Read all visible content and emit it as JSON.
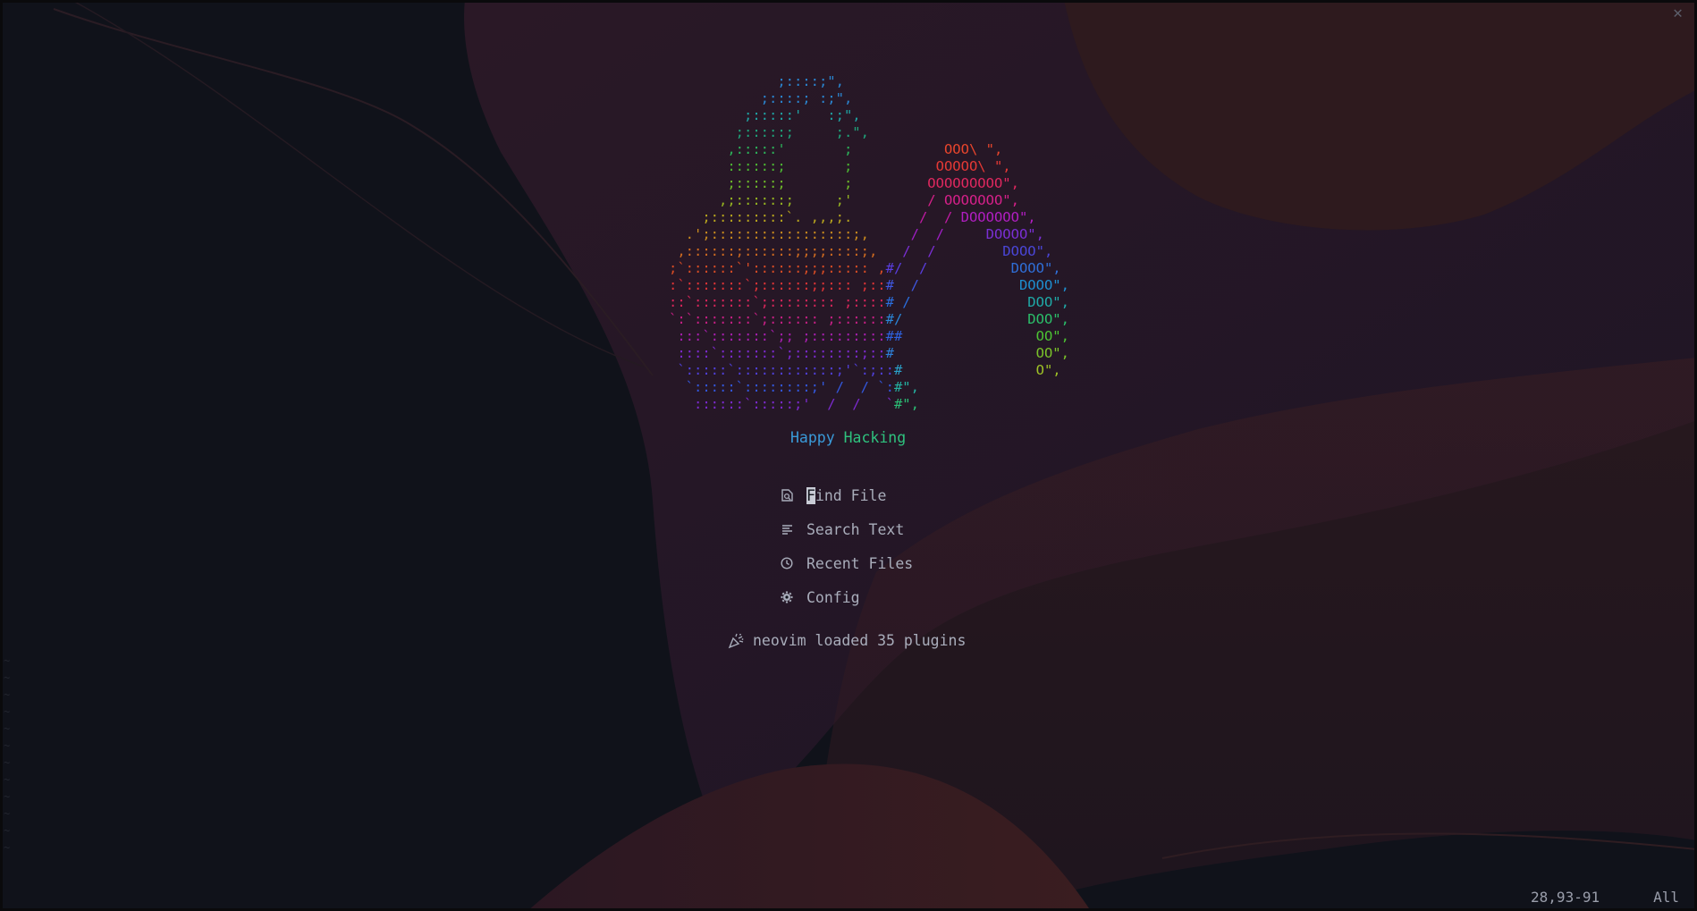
{
  "window": {
    "close_icon": "close-icon"
  },
  "colors": {
    "background": "#10121a",
    "menu_text": "#a9adbb",
    "cursor": "#c9ccd6",
    "tagline_happy": "#3a9ad9",
    "tagline_hacking": "#2ec27e",
    "wave_red": "#3a1b22",
    "wave_purple": "#2a1a2e"
  },
  "logo": {
    "lines": [
      {
        "segs": [
          {
            "t": "             ;::::;\",",
            "c": "#2a86d1"
          }
        ]
      },
      {
        "segs": [
          {
            "t": "           ;::::; :;\",",
            "c": "#2a86d1"
          }
        ]
      },
      {
        "segs": [
          {
            "t": "         ;:::::'   :;\",",
            "c": "#1fa3a3"
          }
        ]
      },
      {
        "segs": [
          {
            "t": "        ;:::::;     ;.\",",
            "c": "#1fa37a"
          }
        ]
      },
      {
        "segs": [
          {
            "t": "       ,:::::'       ;           ",
            "c": "#2cb35a"
          },
          {
            "t": "OOO\\ \",",
            "c": "#e8452c"
          }
        ]
      },
      {
        "segs": [
          {
            "t": "       ::::::;       ;          ",
            "c": "#4cb833"
          },
          {
            "t": "OOOOO\\ \",",
            "c": "#e53935"
          }
        ]
      },
      {
        "segs": [
          {
            "t": "       ;:::::;       ;         ",
            "c": "#6fbb2a"
          },
          {
            "t": "OOOOOOOOO\",",
            "c": "#e0285f"
          }
        ]
      },
      {
        "segs": [
          {
            "t": "      ,;::::::;     ;'         ",
            "c": "#96b521"
          },
          {
            "t": "/ OOOOOOO\",",
            "c": "#d6208a"
          }
        ]
      },
      {
        "segs": [
          {
            "t": "    ;:::::::::`. ,,,;.        ",
            "c": "#b8a51e"
          },
          {
            "t": "/  / ",
            "c": "#c21ba5"
          },
          {
            "t": "DOOOOOO\",",
            "c": "#b11ec2"
          }
        ]
      },
      {
        "segs": [
          {
            "t": "  .';:::::::::::::::::;,     ",
            "c": "#c98a1e"
          },
          {
            "t": "/  /     ",
            "c": "#a11ec7"
          },
          {
            "t": "DOOOO\",",
            "c": "#7a2fd4"
          }
        ]
      },
      {
        "segs": [
          {
            "t": " ,::::::;::::::;;;;::::;,   ",
            "c": "#d06b20"
          },
          {
            "t": "/  /        ",
            "c": "#7b2fd6"
          },
          {
            "t": "DOOO\",",
            "c": "#4a46d8"
          }
        ]
      },
      {
        "segs": [
          {
            "t": ";`::::::`'::::::;;;::::: ,",
            "c": "#d84c24"
          },
          {
            "t": "#/  /          ",
            "c": "#5a3ee0"
          },
          {
            "t": "DOOO\",",
            "c": "#2f6fd8"
          }
        ]
      },
      {
        "segs": [
          {
            "t": ":`:::::::`;::::::;;::: ;::",
            "c": "#de3436"
          },
          {
            "t": "#  /            ",
            "c": "#3f57e0"
          },
          {
            "t": "DOOO\",",
            "c": "#1e8fd0"
          }
        ]
      },
      {
        "segs": [
          {
            "t": "::`:::::::`;:::::::: ;::::",
            "c": "#d8265a"
          },
          {
            "t": "# /              ",
            "c": "#2a6fe0"
          },
          {
            "t": "DOO\",",
            "c": "#1faaa8"
          }
        ]
      },
      {
        "segs": [
          {
            "t": "`:`:::::::`;:::::: ;::::::",
            "c": "#c81f86"
          },
          {
            "t": "#/               ",
            "c": "#2a86d8"
          },
          {
            "t": "DOO\",",
            "c": "#2bbf6a"
          }
        ]
      },
      {
        "segs": [
          {
            "t": " :::`:::::::`;; ;:::::::::",
            "c": "#a81fb0"
          },
          {
            "t": "##                ",
            "c": "#2e62e0"
          },
          {
            "t": "OO\",",
            "c": "#4cc233"
          }
        ]
      },
      {
        "segs": [
          {
            "t": " ::::`:::::::`;::::::::;::",
            "c": "#7c2ad0"
          },
          {
            "t": "#                 ",
            "c": "#2e80d8"
          },
          {
            "t": "OO\",",
            "c": "#7ac22a"
          }
        ]
      },
      {
        "segs": [
          {
            "t": " `:::::`::::::::::::;'`:;::",
            "c": "#5040da"
          },
          {
            "t": "#                ",
            "c": "#2aa0c8"
          },
          {
            "t": "O\",",
            "c": "#9ec226"
          }
        ]
      },
      {
        "segs": [
          {
            "t": "  `:::::`::::::::;' /  / `:",
            "c": "#3358de"
          },
          {
            "t": "#\",",
            "c": "#24b0a0"
          }
        ]
      },
      {
        "segs": [
          {
            "t": "   ::::::`:::::;'  /  /   `",
            "c": "#7c2ad0"
          },
          {
            "t": "#\",",
            "c": "#2bbd74"
          }
        ]
      }
    ]
  },
  "tagline": {
    "word1": "Happy",
    "word2": "Hacking"
  },
  "menu": [
    {
      "icon": "find-file-icon",
      "first": "F",
      "rest": "ind File",
      "cursor": true
    },
    {
      "icon": "search-text-icon",
      "first": "",
      "rest": "Search Text",
      "cursor": false
    },
    {
      "icon": "clock-icon",
      "first": "",
      "rest": "Recent Files",
      "cursor": false
    },
    {
      "icon": "gear-icon",
      "first": "",
      "rest": "Config",
      "cursor": false
    }
  ],
  "footer": {
    "icon": "party-popper-icon",
    "text": "neovim loaded 35 plugins"
  },
  "ruler": {
    "position": "28,93-91",
    "scroll": "All"
  },
  "gutter": {
    "lines": [
      "~",
      "~",
      "~",
      "~",
      "~",
      "~",
      "~",
      "~",
      "~",
      "~",
      "~",
      "~"
    ]
  }
}
